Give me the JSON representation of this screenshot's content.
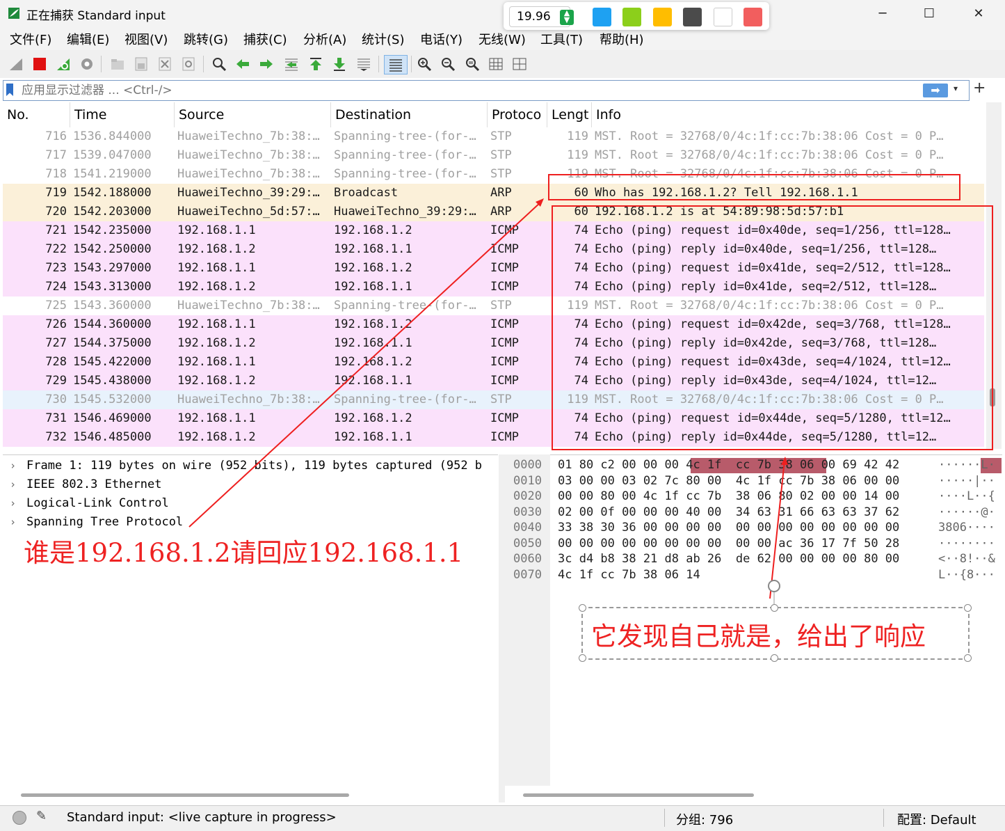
{
  "window": {
    "title": "正在捕获 Standard input",
    "minimize": "─",
    "maximize": "☐",
    "close": "✕"
  },
  "palette": {
    "value": "19.96",
    "colors": [
      "#1ea1f2",
      "#8ccf1b",
      "#ffbd00",
      "#4b4b4b",
      "#ffffff",
      "#f25e5e"
    ]
  },
  "menu": [
    "文件(F)",
    "编辑(E)",
    "视图(V)",
    "跳转(G)",
    "捕获(C)",
    "分析(A)",
    "统计(S)",
    "电话(Y)",
    "无线(W)",
    "工具(T)",
    "帮助(H)"
  ],
  "toolbar": {
    "icons": [
      "shark-fin-icon",
      "stop-icon",
      "restart-icon",
      "options-gear-icon",
      "open-folder-icon",
      "save-icon",
      "close-file-icon",
      "reload-icon",
      "find-icon",
      "back-arrow-icon",
      "forward-arrow-icon",
      "goto-packet-icon",
      "first-packet-icon",
      "last-packet-icon",
      "autoscroll-icon",
      "colorize-icon",
      "zoom-in-icon",
      "zoom-out-icon",
      "zoom-reset-icon",
      "resize-columns-icon",
      "layout-icon"
    ]
  },
  "filter": {
    "placeholder": "应用显示过滤器 ... <Ctrl-/>",
    "apply": "➡",
    "dropdown": "▾",
    "add": "+"
  },
  "columns": [
    "No.",
    "Time",
    "Source",
    "Destination",
    "Protoco",
    "Lengt",
    "Info"
  ],
  "packets": [
    {
      "no": "716",
      "time": "1536.844000",
      "src": "HuaweiTechno_7b:38:…",
      "dst": "Spanning-tree-(for-…",
      "proto": "STP",
      "len": "119",
      "info": "MST. Root = 32768/0/4c:1f:cc:7b:38:06  Cost = 0  P…",
      "type": "stp"
    },
    {
      "no": "717",
      "time": "1539.047000",
      "src": "HuaweiTechno_7b:38:…",
      "dst": "Spanning-tree-(for-…",
      "proto": "STP",
      "len": "119",
      "info": "MST. Root = 32768/0/4c:1f:cc:7b:38:06  Cost = 0  P…",
      "type": "stp"
    },
    {
      "no": "718",
      "time": "1541.219000",
      "src": "HuaweiTechno_7b:38:…",
      "dst": "Spanning-tree-(for-…",
      "proto": "STP",
      "len": "119",
      "info": "MST. Root = 32768/0/4c:1f:cc:7b:38:06  Cost = 0  P…",
      "type": "stp"
    },
    {
      "no": "719",
      "time": "1542.188000",
      "src": "HuaweiTechno_39:29:…",
      "dst": "Broadcast",
      "proto": "ARP",
      "len": "60",
      "info": "Who has 192.168.1.2? Tell 192.168.1.1",
      "type": "arp"
    },
    {
      "no": "720",
      "time": "1542.203000",
      "src": "HuaweiTechno_5d:57:…",
      "dst": "HuaweiTechno_39:29:…",
      "proto": "ARP",
      "len": "60",
      "info": "192.168.1.2 is at 54:89:98:5d:57:b1",
      "type": "arp"
    },
    {
      "no": "721",
      "time": "1542.235000",
      "src": "192.168.1.1",
      "dst": "192.168.1.2",
      "proto": "ICMP",
      "len": "74",
      "info": "Echo (ping) request  id=0x40de, seq=1/256, ttl=128…",
      "type": "icmp"
    },
    {
      "no": "722",
      "time": "1542.250000",
      "src": "192.168.1.2",
      "dst": "192.168.1.1",
      "proto": "ICMP",
      "len": "74",
      "info": "Echo (ping) reply    id=0x40de, seq=1/256, ttl=128…",
      "type": "icmp"
    },
    {
      "no": "723",
      "time": "1543.297000",
      "src": "192.168.1.1",
      "dst": "192.168.1.2",
      "proto": "ICMP",
      "len": "74",
      "info": "Echo (ping) request  id=0x41de, seq=2/512, ttl=128…",
      "type": "icmp"
    },
    {
      "no": "724",
      "time": "1543.313000",
      "src": "192.168.1.2",
      "dst": "192.168.1.1",
      "proto": "ICMP",
      "len": "74",
      "info": "Echo (ping) reply    id=0x41de, seq=2/512, ttl=128…",
      "type": "icmp"
    },
    {
      "no": "725",
      "time": "1543.360000",
      "src": "HuaweiTechno_7b:38:…",
      "dst": "Spanning-tree-(for-…",
      "proto": "STP",
      "len": "119",
      "info": "MST. Root = 32768/0/4c:1f:cc:7b:38:06  Cost = 0  P…",
      "type": "stp"
    },
    {
      "no": "726",
      "time": "1544.360000",
      "src": "192.168.1.1",
      "dst": "192.168.1.2",
      "proto": "ICMP",
      "len": "74",
      "info": "Echo (ping) request  id=0x42de, seq=3/768, ttl=128…",
      "type": "icmp"
    },
    {
      "no": "727",
      "time": "1544.375000",
      "src": "192.168.1.2",
      "dst": "192.168.1.1",
      "proto": "ICMP",
      "len": "74",
      "info": "Echo (ping) reply    id=0x42de, seq=3/768, ttl=128…",
      "type": "icmp"
    },
    {
      "no": "728",
      "time": "1545.422000",
      "src": "192.168.1.1",
      "dst": "192.168.1.2",
      "proto": "ICMP",
      "len": "74",
      "info": "Echo (ping) request  id=0x43de, seq=4/1024, ttl=12…",
      "type": "icmp"
    },
    {
      "no": "729",
      "time": "1545.438000",
      "src": "192.168.1.2",
      "dst": "192.168.1.1",
      "proto": "ICMP",
      "len": "74",
      "info": "Echo (ping) reply    id=0x43de, seq=4/1024, ttl=12…",
      "type": "icmp"
    },
    {
      "no": "730",
      "time": "1545.532000",
      "src": "HuaweiTechno_7b:38:…",
      "dst": "Spanning-tree-(for-…",
      "proto": "STP",
      "len": "119",
      "info": "MST. Root = 32768/0/4c:1f:cc:7b:38:06  Cost = 0  P…",
      "type": "stp-sel"
    },
    {
      "no": "731",
      "time": "1546.469000",
      "src": "192.168.1.1",
      "dst": "192.168.1.2",
      "proto": "ICMP",
      "len": "74",
      "info": "Echo (ping) request  id=0x44de, seq=5/1280, ttl=12…",
      "type": "icmp"
    },
    {
      "no": "732",
      "time": "1546.485000",
      "src": "192.168.1.2",
      "dst": "192.168.1.1",
      "proto": "ICMP",
      "len": "74",
      "info": "Echo (ping) reply    id=0x44de, seq=5/1280, ttl=12…",
      "type": "icmp"
    }
  ],
  "details": [
    "Frame 1: 119 bytes on wire (952 bits), 119 bytes captured (952 b",
    "IEEE 802.3 Ethernet",
    "Logical-Link Control",
    "Spanning Tree Protocol"
  ],
  "details_arrow": "›",
  "bytes": [
    {
      "off": "0000",
      "hex": "01 80 c2 00 00 00 4c 1f  cc 7b 38 06 00 69 42 42",
      "ascii": "······L·"
    },
    {
      "off": "0010",
      "hex": "03 00 00 03 02 7c 80 00  4c 1f cc 7b 38 06 00 00",
      "ascii": "·····|··"
    },
    {
      "off": "0020",
      "hex": "00 00 80 00 4c 1f cc 7b  38 06 80 02 00 00 14 00",
      "ascii": "····L··{"
    },
    {
      "off": "0030",
      "hex": "02 00 0f 00 00 00 40 00  34 63 31 66 63 63 37 62",
      "ascii": "······@·"
    },
    {
      "off": "0040",
      "hex": "33 38 30 36 00 00 00 00  00 00 00 00 00 00 00 00",
      "ascii": "3806····"
    },
    {
      "off": "0050",
      "hex": "00 00 00 00 00 00 00 00  00 00 ac 36 17 7f 50 28",
      "ascii": "········"
    },
    {
      "off": "0060",
      "hex": "3c d4 b8 38 21 d8 ab 26  de 62 00 00 00 00 80 00",
      "ascii": "<··8!··&"
    },
    {
      "off": "0070",
      "hex": "4c 1f cc 7b 38 06 14",
      "ascii": "L··{8···"
    }
  ],
  "status": {
    "capture": "Standard input: <live capture in progress>",
    "packets": "分组: 796",
    "profile": "配置: Default"
  },
  "annotations": {
    "ask": "谁是192.168.1.2请回应192.168.1.1",
    "reply": "它发现自己就是，给出了响应",
    "color": "#ee1f1f"
  }
}
